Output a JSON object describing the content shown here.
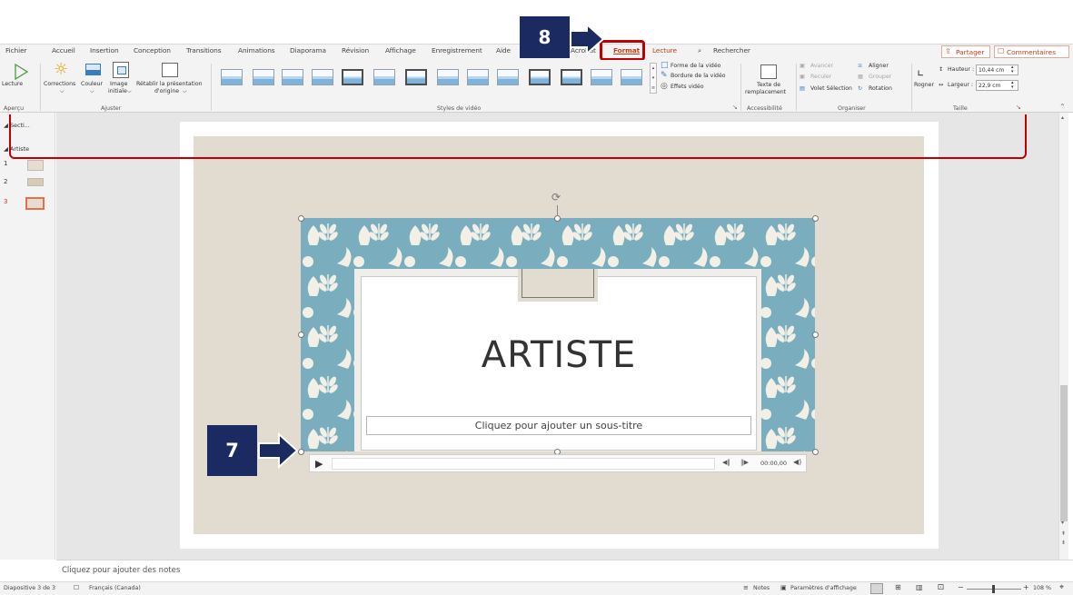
{
  "menu": {
    "tabs": [
      "Fichier",
      "Accueil",
      "Insertion",
      "Conception",
      "Transitions",
      "Animations",
      "Diaporama",
      "Révision",
      "Affichage",
      "Enregistrement",
      "Aide",
      "Acrobat",
      "Format",
      "Lecture",
      "Rechercher"
    ],
    "share": "Partager",
    "comments": "Commentaires"
  },
  "ribbon": {
    "lecture": "Lecture",
    "apercu": "Aperçu",
    "corrections": "Corrections",
    "couleur": "Couleur",
    "image_initiale_1": "Image",
    "image_initiale_2": "initiale",
    "retablir_1": "Rétablir la présentation",
    "retablir_2": "d'origine",
    "ajuster": "Ajuster",
    "forme_video": "Forme de la vidéo",
    "bordure_video": "Bordure de la vidéo",
    "effets_video": "Effets vidéo",
    "styles_video": "Styles de vidéo",
    "texte_de": "Texte de",
    "remplacement": "remplacement",
    "accessibilite": "Accessibilité",
    "avancer": "Avancer",
    "reculer": "Reculer",
    "volet_selection": "Volet Sélection",
    "aligner": "Aligner",
    "grouper": "Grouper",
    "rotation": "Rotation",
    "organiser": "Organiser",
    "rogner": "Rogner",
    "hauteur_label": "Hauteur :",
    "hauteur_value": "10,44 cm",
    "largeur_label": "Largeur :",
    "largeur_value": "22,9 cm",
    "taille": "Taille"
  },
  "panel": {
    "section1": "Secti...",
    "section2": "Artiste",
    "slides": [
      "1",
      "2",
      "3"
    ]
  },
  "slide": {
    "title": "ARTISTE",
    "subtitle_placeholder": "Cliquez pour ajouter un sous-titre",
    "player_time": "00:00,00"
  },
  "notes": {
    "placeholder": "Cliquez pour ajouter des notes"
  },
  "status": {
    "slide_info": "Diapositive 3 de 3",
    "language": "Français (Canada)",
    "notes": "Notes",
    "display": "Paramètres d'affichage",
    "zoom": "108 %"
  },
  "callouts": {
    "step7": "7",
    "step8": "8"
  },
  "colors": {
    "accent": "#c43e1c",
    "callout_bg": "#1b2b61",
    "highlight": "#c00000"
  }
}
